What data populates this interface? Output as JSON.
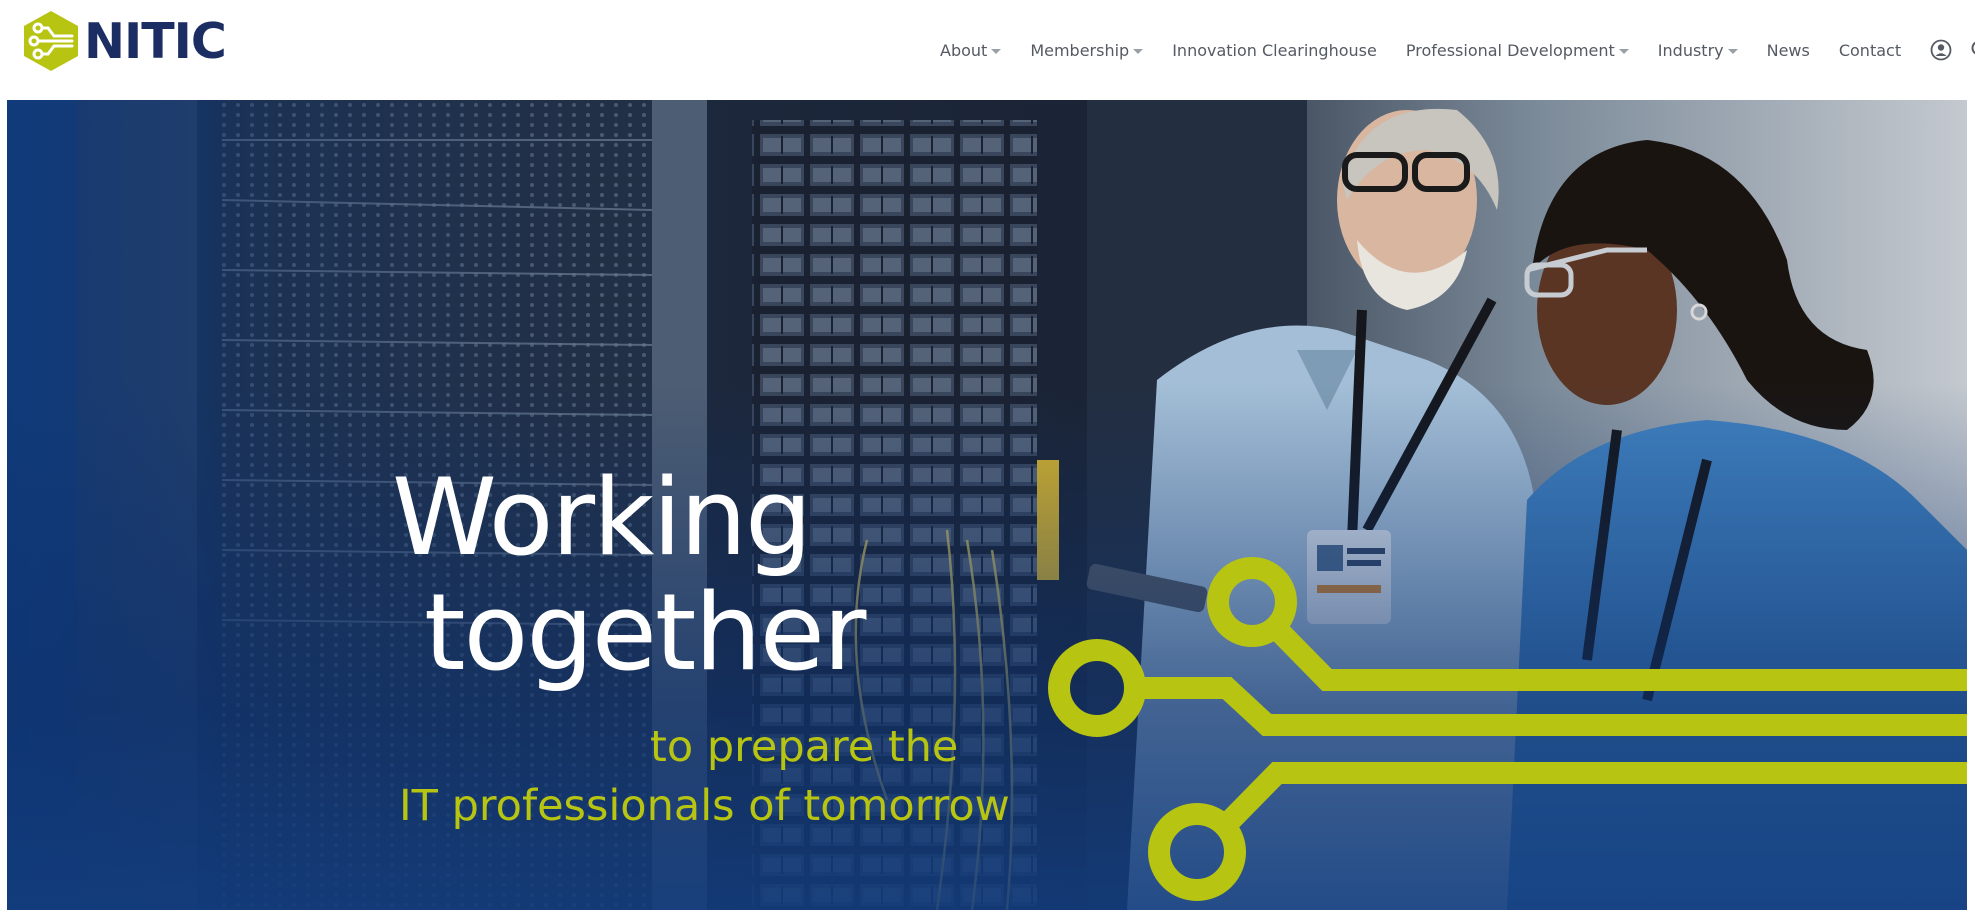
{
  "brand": {
    "name": "NITIC",
    "accent_color": "#b8c412",
    "navy_color": "#1c2d63"
  },
  "nav": {
    "items": [
      {
        "label": "About",
        "has_dropdown": true
      },
      {
        "label": "Membership",
        "has_dropdown": true
      },
      {
        "label": "Innovation Clearinghouse",
        "has_dropdown": false
      },
      {
        "label": "Professional Development",
        "has_dropdown": true
      },
      {
        "label": "Industry",
        "has_dropdown": true
      },
      {
        "label": "News",
        "has_dropdown": false
      },
      {
        "label": "Contact",
        "has_dropdown": false
      }
    ],
    "icons": [
      "account-icon",
      "search-icon"
    ]
  },
  "hero": {
    "headline_line1": "Working",
    "headline_line2": "together",
    "subline_line1": "to prepare the",
    "subline_line2": "IT professionals of tomorrow"
  }
}
